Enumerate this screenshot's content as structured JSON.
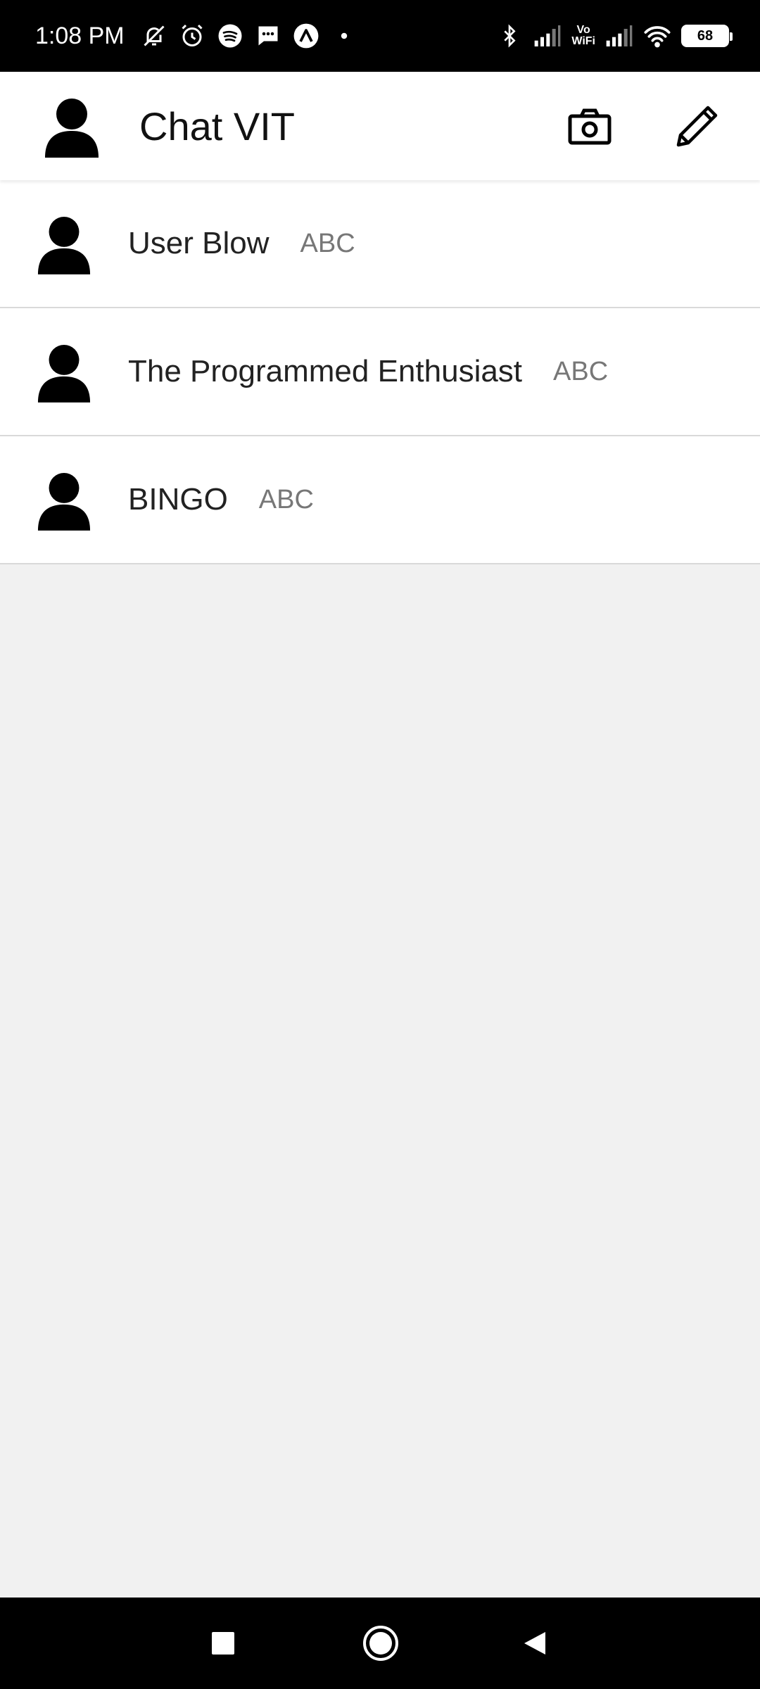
{
  "status_bar": {
    "time": "1:08 PM",
    "icons_left": [
      "mute-icon",
      "alarm-icon",
      "spotify-icon",
      "message-icon",
      "app-icon",
      "dot-icon"
    ],
    "icons_right": [
      "bluetooth-icon",
      "signal-icon",
      "vowifi-icon",
      "signal-icon",
      "wifi-icon",
      "battery-icon"
    ],
    "vowifi_top": "Vo",
    "vowifi_bottom": "WiFi",
    "battery_level": "68"
  },
  "app_bar": {
    "title": "Chat VIT",
    "actions": [
      "camera-icon",
      "pencil-icon"
    ]
  },
  "chats": [
    {
      "name": "User Blow",
      "preview": "ABC"
    },
    {
      "name": "The Programmed Enthusiast",
      "preview": "ABC"
    },
    {
      "name": "BINGO",
      "preview": "ABC"
    }
  ],
  "nav_bar": {
    "buttons": [
      "recents-icon",
      "home-icon",
      "back-icon"
    ]
  },
  "colors": {
    "status_bar_bg": "#000000",
    "app_bar_bg": "#ffffff",
    "list_bg": "#ffffff",
    "empty_bg": "#f1f1f1",
    "divider": "#d9d9d9",
    "name_text": "#222222",
    "preview_text": "#777777"
  }
}
